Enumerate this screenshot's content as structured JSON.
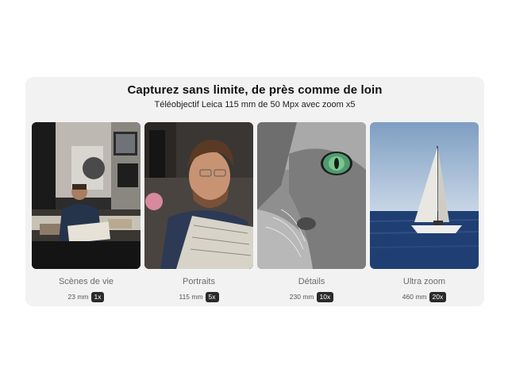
{
  "header": {
    "title": "Capturez sans limite, de près comme de loin",
    "subtitle": "Téléobjectif Leica 115 mm de 50 Mpx avec zoom x5"
  },
  "tiles": [
    {
      "label": "Scènes de vie",
      "focal": "23 mm",
      "zoom": "1x",
      "image": "man-reading-newspaper-wide"
    },
    {
      "label": "Portraits",
      "focal": "115 mm",
      "zoom": "5x",
      "image": "man-reading-newspaper-portrait"
    },
    {
      "label": "Détails",
      "focal": "230 mm",
      "zoom": "10x",
      "image": "grey-cat-eye-closeup"
    },
    {
      "label": "Ultra zoom",
      "focal": "460 mm",
      "zoom": "20x",
      "image": "sailboat-on-sea"
    }
  ],
  "colors": {
    "card_background": "#f2f2f2",
    "badge_background": "#2a2a2a",
    "caption_text": "#6b6b6b"
  }
}
